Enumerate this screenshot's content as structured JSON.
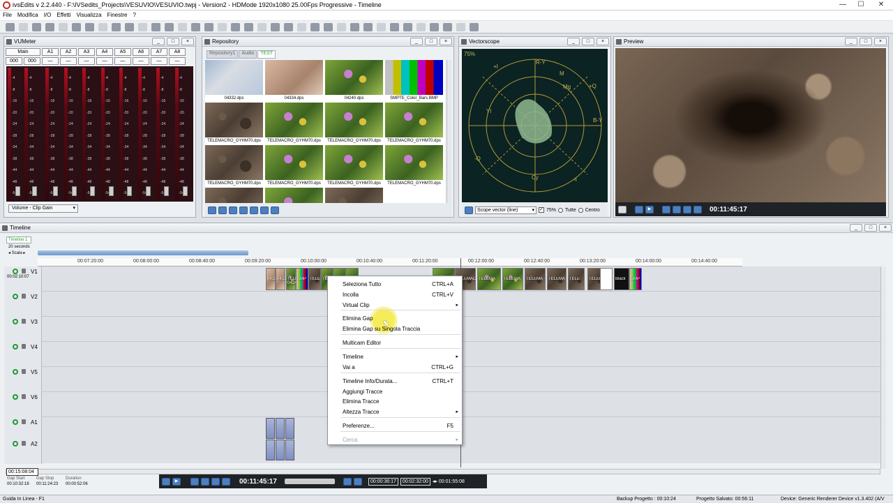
{
  "app": {
    "title": "ivsEdits v 2.2.440 - F:\\IVSedits_Projects\\VESUVIO\\VESUVIO.twpj - Version2 - HDMode 1920x1080 25.00Fps Progressive - Timeline",
    "win_min": "—",
    "win_max": "☐",
    "win_close": "✕"
  },
  "menu": [
    "File",
    "Modifica",
    "I/O",
    "Effetti",
    "Visualizza",
    "Finestre",
    "?"
  ],
  "panels": {
    "vumeter": {
      "title": "VUMeter",
      "main": "Main",
      "channels": [
        "A1",
        "A2",
        "A3",
        "A4",
        "A5",
        "A6",
        "A7",
        "A8"
      ],
      "main_vals": [
        "000",
        "000"
      ],
      "dash": "—",
      "dropdown": "Volume - Clip Gain"
    },
    "repository": {
      "title": "Repository",
      "tabs": [
        "Repository1",
        "Audio",
        "TEST"
      ]
    },
    "vectorscope": {
      "title": "Vectorscope",
      "pct_label": "75%",
      "mode": "Scope vector (line)",
      "pct": "75%",
      "opt1": "Tutte",
      "opt2": "Centro",
      "labels": [
        "R-Y",
        "M",
        "Mg",
        "+Q",
        "+I",
        "Yl",
        "B-Y",
        "-Q",
        "Cy",
        "-I"
      ]
    },
    "preview": {
      "title": "Preview",
      "timecode": "00:11:45:17"
    },
    "timeline": {
      "title": "Timeline",
      "tab": "Timeline 1",
      "scale_text": "20 seconds",
      "scale_label": "Scala"
    }
  },
  "thumbs": [
    {
      "cap": "04332.dps",
      "style": "feet"
    },
    {
      "cap": "04334.dps",
      "style": "blur"
    },
    {
      "cap": "04240.dps",
      "style": "flower"
    },
    {
      "cap": "SMPTE_Color_Bars.BMP",
      "style": "bars"
    },
    {
      "cap": "TELEMACRO_GYHM70.dps",
      "style": "dirt"
    },
    {
      "cap": "TELEMACRO_GYHM70.dps",
      "style": "flower"
    },
    {
      "cap": "TELEMACRO_GYHM70.dps",
      "style": "flower"
    },
    {
      "cap": "TELEMACRO_GYHM70.dps",
      "style": "flower"
    },
    {
      "cap": "TELEMACRO_GYHM70.dps",
      "style": "dirt"
    },
    {
      "cap": "TELEMACRO_GYHM70.dps",
      "style": "flower"
    },
    {
      "cap": "TELEMACRO_GYHM70.dps",
      "style": "flower"
    },
    {
      "cap": "TELEMACRO_GYHM70.dps",
      "style": "flower"
    },
    {
      "cap": "",
      "style": "dirt"
    },
    {
      "cap": "",
      "style": "flower"
    },
    {
      "cap": "",
      "style": "dirt"
    },
    {
      "cap": "",
      "style": "white"
    }
  ],
  "ruler": [
    "00:07:20:00",
    "00:08:00:00",
    "00:08:40:00",
    "00:09:20:00",
    "00:10:00:00",
    "00:10:40:00",
    "00:11:20:00",
    "00:12:00:00",
    "00:12:40:00",
    "00:13:20:00",
    "00:14:00:00",
    "00:14:40:00"
  ],
  "tracks": [
    {
      "name": "V1",
      "tc": "00:02:10:07"
    },
    {
      "name": "V2",
      "tc": ""
    },
    {
      "name": "V3",
      "tc": ""
    },
    {
      "name": "V4",
      "tc": ""
    },
    {
      "name": "V5",
      "tc": ""
    },
    {
      "name": "V6",
      "tc": ""
    },
    {
      "name": "A1",
      "tc": ""
    },
    {
      "name": "A2",
      "tc": ""
    }
  ],
  "v1_clips": [
    "0433",
    "0433",
    "TELE\n0424",
    "SMP",
    "TELE",
    "TELE",
    "",
    "",
    "TELEMAC",
    "TELEMAC",
    "TELEMA",
    "TELEMA",
    "TELEMA",
    "TELEMA",
    "TELE",
    "TELEMA",
    "",
    "Black",
    "SMP"
  ],
  "context_menu": [
    {
      "label": "Seleziona Tutto",
      "shortcut": "CTRL+A",
      "arrow": "",
      "disabled": false
    },
    {
      "label": "Incolla",
      "shortcut": "CTRL+V",
      "arrow": "",
      "disabled": false
    },
    {
      "label": "Virtual Clip",
      "shortcut": "",
      "arrow": "▸",
      "disabled": false
    },
    {
      "label": "Elimina Gap",
      "shortcut": "",
      "arrow": "",
      "disabled": false
    },
    {
      "label": "Elimina Gap su Singola Traccia",
      "shortcut": "",
      "arrow": "",
      "disabled": false
    },
    {
      "label": "Multicam Editor",
      "shortcut": "",
      "arrow": "",
      "disabled": false
    },
    {
      "label": "Timeline",
      "shortcut": "",
      "arrow": "▸",
      "disabled": false
    },
    {
      "label": "Vai a",
      "shortcut": "CTRL+G",
      "arrow": "",
      "disabled": false
    },
    {
      "label": "Timeline Info/Durata...",
      "shortcut": "CTRL+T",
      "arrow": "",
      "disabled": false
    },
    {
      "label": "Aggiungi Tracce",
      "shortcut": "",
      "arrow": "",
      "disabled": false
    },
    {
      "label": "Elimina Tracce",
      "shortcut": "",
      "arrow": "",
      "disabled": false
    },
    {
      "label": "Altezza Tracce",
      "shortcut": "",
      "arrow": "▸",
      "disabled": false
    },
    {
      "label": "Preferenze...",
      "shortcut": "F5",
      "arrow": "",
      "disabled": false
    },
    {
      "label": "Cerca",
      "shortcut": "",
      "arrow": "▸",
      "disabled": true
    }
  ],
  "transport": {
    "current_tc": "00:15:08:04",
    "gap_start_label": "Gap Start",
    "gap_stop_label": "Gap Stop",
    "duration_label": "Duration",
    "gap_start": "00:10:32:18",
    "gap_stop": "00:11:24:23",
    "duration": "00:00:52:06",
    "main_tc": "00:11:45:17",
    "in_tc": "00:00:36:17",
    "out_tc": "00:02:32:00",
    "dur_tc": "00:01:55:08"
  },
  "status": {
    "left": "Guida In Linea - F1",
    "backup": "Backup Progetto : 00:10:24",
    "saved": "Progetto Salvato: 00:56:11",
    "device": "Device: Generic Renderer Device v1.3.402 (A/V"
  },
  "colors": {
    "accent": "#4d7fbf",
    "vu_bg": "#2a0f14",
    "scope_bg": "#0b2322",
    "highlight": "#f5ec5a"
  }
}
